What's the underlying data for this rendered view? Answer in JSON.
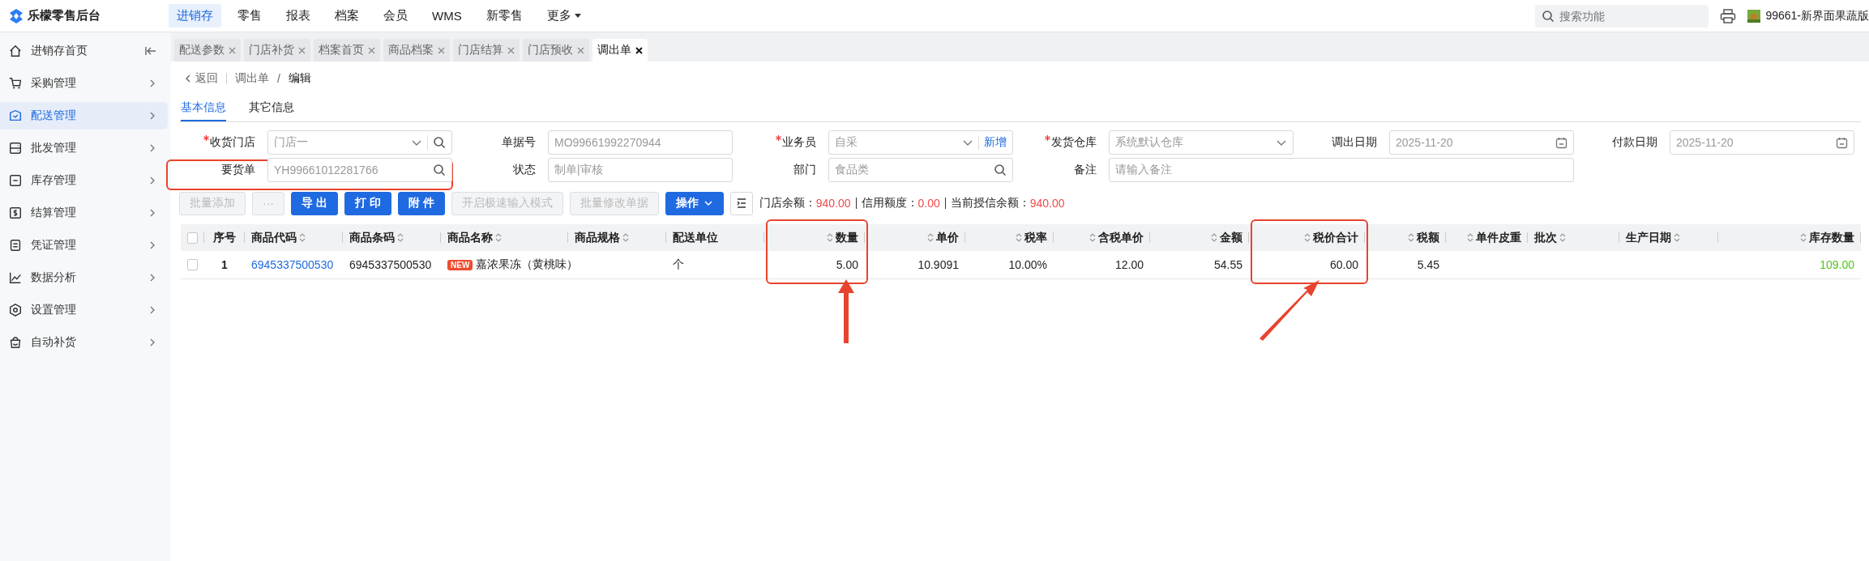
{
  "brand": {
    "name": "乐檬零售后台"
  },
  "top_nav": [
    {
      "label": "进销存",
      "selected": true
    },
    {
      "label": "零售",
      "selected": false
    },
    {
      "label": "报表",
      "selected": false
    },
    {
      "label": "档案",
      "selected": false
    },
    {
      "label": "会员",
      "selected": false
    },
    {
      "label": "WMS",
      "selected": false
    },
    {
      "label": "新零售",
      "selected": false
    },
    {
      "label": "更多",
      "selected": false,
      "kind": "dropdown"
    }
  ],
  "search": {
    "placeholder": "搜索功能"
  },
  "user": {
    "name": "99661-新界面果蔬版"
  },
  "sidebar": {
    "items": [
      {
        "label": "进销存首页",
        "selected": false,
        "kind": "home"
      },
      {
        "label": "采购管理",
        "selected": false
      },
      {
        "label": "配送管理",
        "selected": true
      },
      {
        "label": "批发管理",
        "selected": false
      },
      {
        "label": "库存管理",
        "selected": false
      },
      {
        "label": "结算管理",
        "selected": false
      },
      {
        "label": "凭证管理",
        "selected": false
      },
      {
        "label": "数据分析",
        "selected": false
      },
      {
        "label": "设置管理",
        "selected": false
      },
      {
        "label": "自动补货",
        "selected": false
      }
    ]
  },
  "page_tabs": [
    {
      "label": "配送参数",
      "selected": false
    },
    {
      "label": "门店补货",
      "selected": false
    },
    {
      "label": "档案首页",
      "selected": false
    },
    {
      "label": "商品档案",
      "selected": false
    },
    {
      "label": "门店结算",
      "selected": false
    },
    {
      "label": "门店预收",
      "selected": false
    },
    {
      "label": "调出单",
      "selected": true
    }
  ],
  "breadcrumb": {
    "back": "返回",
    "separator": "/",
    "items": [
      "调出单",
      "编辑"
    ]
  },
  "sub_tabs": [
    {
      "label": "基本信息",
      "selected": true
    },
    {
      "label": "其它信息",
      "selected": false
    }
  ],
  "form": {
    "rows": [
      [
        {
          "label": "收货门店",
          "required": true,
          "kind": "select-search",
          "value": "门店一",
          "highlighted": false
        },
        {
          "label": "单据号",
          "required": false,
          "kind": "input",
          "value": "MO99661992270944",
          "highlighted": false
        },
        {
          "label": "业务员",
          "required": true,
          "kind": "select-add",
          "value": "自采",
          "action": "新增",
          "highlighted": false
        },
        {
          "label": "发货仓库",
          "required": true,
          "kind": "select",
          "value": "系统默认仓库",
          "highlighted": false
        },
        {
          "label": "调出日期",
          "required": false,
          "kind": "date",
          "value": "2025-11-20",
          "highlighted": false
        },
        {
          "label": "付款日期",
          "required": false,
          "kind": "date",
          "value": "2025-11-20",
          "highlighted": false
        }
      ],
      [
        {
          "label": "要货单",
          "required": false,
          "kind": "search",
          "value": "YH99661012281766",
          "highlighted": true
        },
        {
          "label": "状态",
          "required": false,
          "kind": "input",
          "value": "制单|审核",
          "highlighted": false
        },
        {
          "label": "部门",
          "required": false,
          "kind": "search",
          "value": "食品类",
          "highlighted": false
        },
        {
          "label": "备注",
          "required": false,
          "kind": "wide",
          "placeholder": "请输入备注",
          "highlighted": false
        }
      ]
    ]
  },
  "toolbar": [
    {
      "label": "批量添加",
      "kind": "default",
      "disabled": true
    },
    {
      "label": "···",
      "kind": "default",
      "disabled": true
    },
    {
      "label": "导 出",
      "kind": "primary",
      "disabled": false
    },
    {
      "label": "打 印",
      "kind": "primary",
      "disabled": false
    },
    {
      "label": "附 件",
      "kind": "primary",
      "disabled": false
    },
    {
      "label": "开启极速输入模式",
      "kind": "default",
      "disabled": true
    },
    {
      "label": "批量修改单据",
      "kind": "default",
      "disabled": true
    },
    {
      "label": "操作",
      "kind": "primary-dropdown",
      "disabled": false
    },
    {
      "kind": "icon",
      "disabled": false
    }
  ],
  "balances": [
    {
      "label": "门店余额：",
      "value": "940.00"
    },
    {
      "label": "信用额度：",
      "value": "0.00"
    },
    {
      "label": "当前授信余额：",
      "value": "940.00"
    }
  ],
  "table": {
    "header_checked": false,
    "columns": [
      {
        "label": "序号",
        "kind": "index",
        "sortable": false,
        "highlighted": false
      },
      {
        "label": "商品代码",
        "kind": "link",
        "sortable": true,
        "highlighted": false
      },
      {
        "label": "商品条码",
        "kind": "text",
        "sortable": true,
        "highlighted": false
      },
      {
        "label": "商品名称",
        "kind": "name",
        "sortable": true,
        "highlighted": false
      },
      {
        "label": "商品规格",
        "kind": "text",
        "sortable": true,
        "highlighted": false
      },
      {
        "label": "配送单位",
        "kind": "text",
        "sortable": false,
        "highlighted": false
      },
      {
        "label": "数量",
        "kind": "number",
        "sortable": true,
        "highlighted": true
      },
      {
        "label": "单价",
        "kind": "number",
        "sortable": true,
        "highlighted": false
      },
      {
        "label": "税率",
        "kind": "number",
        "sortable": true,
        "highlighted": false
      },
      {
        "label": "含税单价",
        "kind": "number",
        "sortable": true,
        "highlighted": false
      },
      {
        "label": "金额",
        "kind": "number",
        "sortable": true,
        "highlighted": false
      },
      {
        "label": "税价合计",
        "kind": "number",
        "sortable": true,
        "highlighted": true
      },
      {
        "label": "税额",
        "kind": "number",
        "sortable": true,
        "highlighted": false
      },
      {
        "label": "单件皮重",
        "kind": "number",
        "sortable": true,
        "highlighted": false
      },
      {
        "label": "批次",
        "kind": "text",
        "sortable": true,
        "highlighted": false
      },
      {
        "label": "生产日期",
        "kind": "text",
        "sortable": true,
        "highlighted": false
      },
      {
        "label": "库存数量",
        "kind": "stock",
        "sortable": true,
        "highlighted": false
      }
    ],
    "rows": [
      {
        "checked": false,
        "badge": "NEW",
        "cells": [
          "1",
          "6945337500530",
          "6945337500530",
          "嘉浓果冻（黄桃味）",
          null,
          "个",
          "5.00",
          "10.9091",
          "10.00%",
          "12.00",
          "54.55",
          "60.00",
          "5.45",
          null,
          null,
          null,
          "109.00"
        ]
      }
    ]
  }
}
